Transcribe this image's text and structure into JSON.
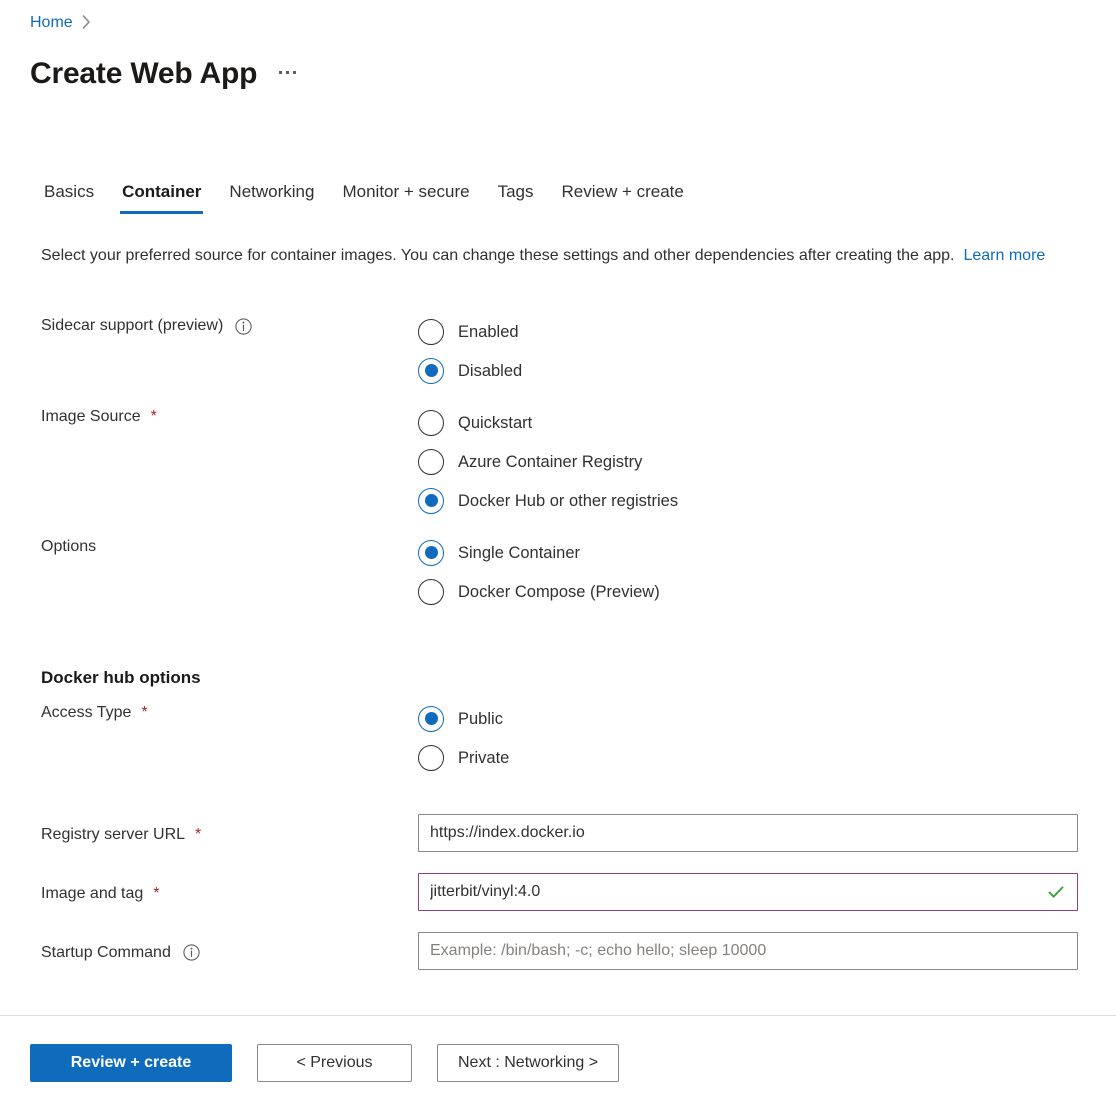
{
  "breadcrumb": {
    "home_label": "Home",
    "separator": "chevron-right"
  },
  "header": {
    "title": "Create Web App",
    "more_menu_label": "..."
  },
  "tabs": [
    {
      "label": "Basics",
      "active": false
    },
    {
      "label": "Container",
      "active": true
    },
    {
      "label": "Networking",
      "active": false
    },
    {
      "label": "Monitor + secure",
      "active": false
    },
    {
      "label": "Tags",
      "active": false
    },
    {
      "label": "Review + create",
      "active": false
    }
  ],
  "description": {
    "text": "Select your preferred source for container images. You can change these settings and other dependencies after creating the app.",
    "link_label": "Learn more"
  },
  "fields": {
    "sidecar_support": {
      "label": "Sidecar support (preview)",
      "has_info_icon": true,
      "required": false,
      "options": [
        {
          "label": "Enabled",
          "selected": false
        },
        {
          "label": "Disabled",
          "selected": true
        }
      ]
    },
    "image_source": {
      "label": "Image Source",
      "required": true,
      "options": [
        {
          "label": "Quickstart",
          "selected": false
        },
        {
          "label": "Azure Container Registry",
          "selected": false
        },
        {
          "label": "Docker Hub or other registries",
          "selected": true
        }
      ]
    },
    "options": {
      "label": "Options",
      "required": false,
      "options": [
        {
          "label": "Single Container",
          "selected": true
        },
        {
          "label": "Docker Compose (Preview)",
          "selected": false
        }
      ]
    },
    "docker_hub_heading": "Docker hub options",
    "access_type": {
      "label": "Access Type",
      "required": true,
      "options": [
        {
          "label": "Public",
          "selected": true
        },
        {
          "label": "Private",
          "selected": false
        }
      ]
    },
    "registry_server_url": {
      "label": "Registry server URL",
      "required": true,
      "value": "https://index.docker.io",
      "placeholder": ""
    },
    "image_and_tag": {
      "label": "Image and tag",
      "required": true,
      "value": "jitterbit/vinyl:4.0",
      "placeholder": "",
      "validated": true,
      "validation_icon": "green-check-icon"
    },
    "startup_command": {
      "label": "Startup Command",
      "has_info_icon": true,
      "required": false,
      "value": "",
      "placeholder": "Example: /bin/bash; -c; echo hello; sleep 10000"
    }
  },
  "footer": {
    "review_create_label": "Review + create",
    "previous_label": "< Previous",
    "next_label": "Next : Networking >"
  },
  "colors": {
    "accent": "#0f6cbd",
    "required_star": "#a4262c",
    "validated_border": "#8a3d8a",
    "validation_check": "#3fa03f",
    "input_border": "#8a8886",
    "text": "#323130"
  }
}
